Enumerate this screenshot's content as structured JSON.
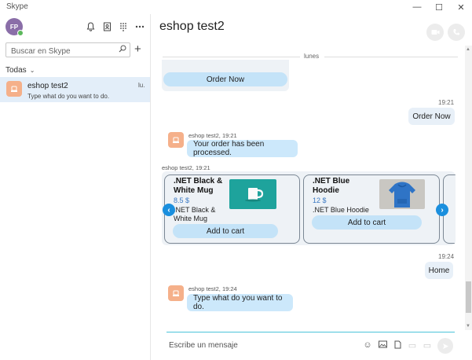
{
  "window": {
    "title": "Skype",
    "minimize_icon": "minimize-icon",
    "maximize_icon": "maximize-icon",
    "close_icon": "close-icon"
  },
  "sidebar": {
    "avatar_initials": "FP",
    "presence_color": "#5cb85c",
    "search_placeholder": "Buscar en Skype",
    "filter_label": "Todas",
    "conversations": [
      {
        "name": "eshop test2",
        "preview": "Type what do you want to do.",
        "time": "lu."
      }
    ]
  },
  "header": {
    "title": "eshop test2"
  },
  "chat": {
    "date_divider": "lunes",
    "top_card_button": "Order Now",
    "messages": [
      {
        "type": "outgoing",
        "time": "19:21",
        "text": "Order Now"
      },
      {
        "type": "incoming",
        "sender": "eshop test2, 19:21",
        "text": "Your order has been processed."
      },
      {
        "type": "carousel",
        "sender": "eshop test2, 19:21"
      },
      {
        "type": "outgoing",
        "time": "19:24",
        "text": "Home"
      },
      {
        "type": "incoming",
        "sender": "eshop test2, 19:24",
        "text": "Type what do you want to do."
      }
    ],
    "products": [
      {
        "title_line1": ".NET Black &",
        "title_line2": "White Mug",
        "price": "8.5 $",
        "desc_line1": ".NET Black &",
        "desc_line2": "White Mug",
        "button": "Add to cart"
      },
      {
        "title_line1": ".NET Blue",
        "title_line2": "Hoodie",
        "price": "12 $",
        "desc_line1": ".NET Blue Hoodie",
        "desc_line2": "",
        "button": "Add to cart"
      }
    ]
  },
  "composer": {
    "placeholder": "Escribe un mensaje"
  },
  "colors": {
    "accent": "#1a8fde",
    "bubble_in": "#cce8fb",
    "bubble_out": "#e8f0f8",
    "selected_conversation": "#e3eef9",
    "bot_avatar": "#f5b08a"
  }
}
